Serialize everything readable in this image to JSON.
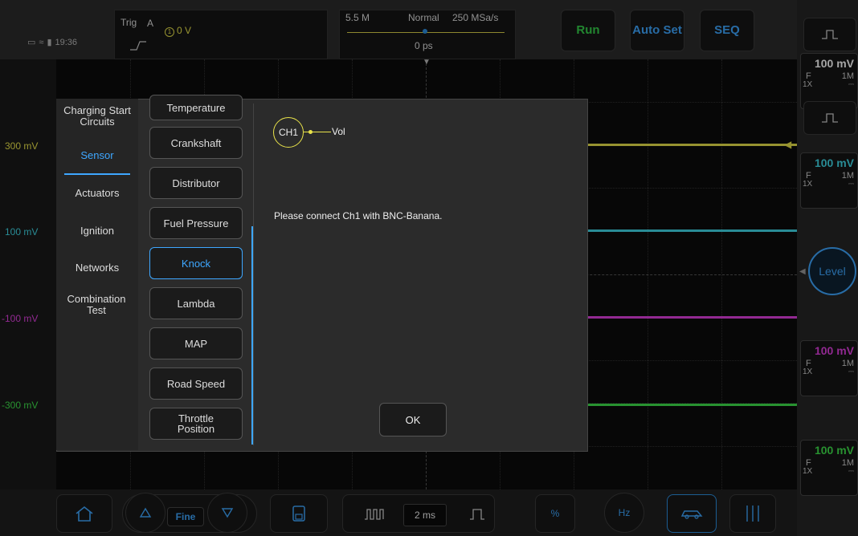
{
  "status": {
    "time": "19:36"
  },
  "trigger": {
    "label": "Trig",
    "channel": "A",
    "level_icon": "1",
    "level": "0 V"
  },
  "timebase": {
    "memory": "5.5 M",
    "mode": "Normal",
    "sample_rate": "250 MSa/s",
    "position": "0 ps"
  },
  "top_buttons": {
    "run": "Run",
    "autoset": "Auto Set",
    "seq": "SEQ"
  },
  "y_labels": [
    {
      "text": "300 mV",
      "color": "#e8e24a"
    },
    {
      "text": "100 mV",
      "color": "#3fd8e6"
    },
    {
      "text": "-100 mV",
      "color": "#e040e0"
    },
    {
      "text": "-300 mV",
      "color": "#3ee04a"
    }
  ],
  "channels": [
    {
      "scale": "100 mV",
      "color": "#ffffff",
      "coupling": "F",
      "impedance": "1M",
      "probe": "1X",
      "dc": "⎓"
    },
    {
      "scale": "100 mV",
      "color": "#3fd8e6",
      "coupling": "F",
      "impedance": "1M",
      "probe": "1X",
      "dc": "⎓"
    },
    {
      "scale": "100 mV",
      "color": "#e040e0",
      "coupling": "F",
      "impedance": "1M",
      "probe": "1X",
      "dc": "⎓"
    },
    {
      "scale": "100 mV",
      "color": "#3ee04a",
      "coupling": "F",
      "impedance": "1M",
      "probe": "1X",
      "dc": "⎓"
    }
  ],
  "level_button": "Level",
  "bottom": {
    "fine": "Fine",
    "time_div": "2 ms"
  },
  "modal": {
    "categories": [
      {
        "label": "Charging Start Circuits",
        "active": false
      },
      {
        "label": "Sensor",
        "active": true
      },
      {
        "label": "Actuators",
        "active": false
      },
      {
        "label": "Ignition",
        "active": false
      },
      {
        "label": "Networks",
        "active": false
      },
      {
        "label": "Combination Test",
        "active": false
      }
    ],
    "sensors": [
      {
        "label": "Temperature",
        "active": false
      },
      {
        "label": "Crankshaft",
        "active": false
      },
      {
        "label": "Distributor",
        "active": false
      },
      {
        "label": "Fuel Pressure",
        "active": false
      },
      {
        "label": "Knock",
        "active": true
      },
      {
        "label": "Lambda",
        "active": false
      },
      {
        "label": "MAP",
        "active": false
      },
      {
        "label": "Road Speed",
        "active": false
      },
      {
        "label": "Throttle Position",
        "active": false
      }
    ],
    "connection": {
      "channel": "CH1",
      "label": "Vol"
    },
    "message": "Please connect Ch1 with BNC-Banana.",
    "ok": "OK"
  }
}
